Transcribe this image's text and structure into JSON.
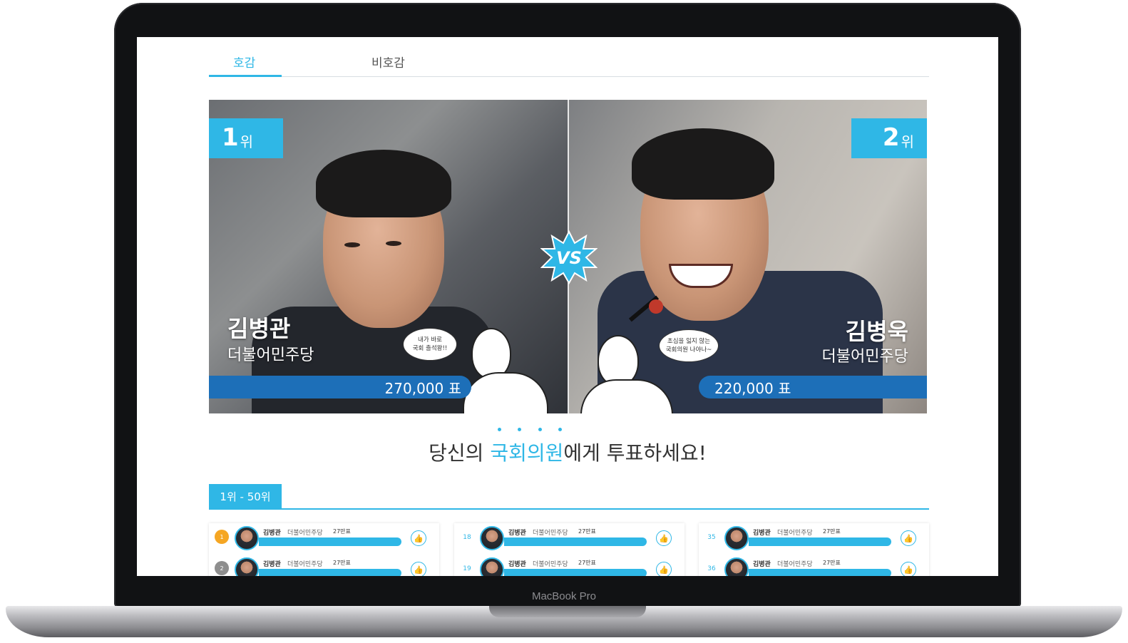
{
  "tabs": [
    {
      "label": "호감",
      "active": true
    },
    {
      "label": "비호감",
      "active": false
    }
  ],
  "hero": {
    "left": {
      "rank_num": "1",
      "rank_suffix": "위",
      "name": "김병관",
      "party": "더불어민주당",
      "votes": "270,000 표",
      "bubble_line1": "내가 바로",
      "bubble_line2": "국회 출석왕!!"
    },
    "right": {
      "rank_num": "2",
      "rank_suffix": "위",
      "name": "김병욱",
      "party": "더불어민주당",
      "votes": "220,000 표",
      "bubble_line1": "초심을 잃지 않는",
      "bubble_line2": "국회의원 나야나~"
    },
    "vs_label": "VS"
  },
  "prompt": {
    "before": "당신의 ",
    "highlight": "국회의원",
    "after": "에게 투표하세요!"
  },
  "range_tab": "1위 - 50위",
  "ranking": {
    "columns": [
      {
        "rows": [
          {
            "rank": "1",
            "name": "김병관",
            "party": "더불어민주당",
            "votes": "27만표",
            "badge": "gold"
          },
          {
            "rank": "2",
            "name": "김병관",
            "party": "더불어민주당",
            "votes": "27만표",
            "badge": "grey"
          }
        ]
      },
      {
        "rows": [
          {
            "rank": "18",
            "name": "김병관",
            "party": "더불어민주당",
            "votes": "27만표"
          },
          {
            "rank": "19",
            "name": "김병관",
            "party": "더불어민주당",
            "votes": "27만표"
          }
        ]
      },
      {
        "rows": [
          {
            "rank": "35",
            "name": "김병관",
            "party": "더불어민주당",
            "votes": "27만표"
          },
          {
            "rank": "36",
            "name": "김병관",
            "party": "더불어민주당",
            "votes": "27만표"
          }
        ]
      }
    ]
  },
  "device_label": "MacBook Pro",
  "colors": {
    "accent": "#2fb7e6",
    "vote_bar": "#1d6fb8"
  },
  "icons": {
    "like": "thumbs-up-icon",
    "vs": "vs-burst-icon"
  }
}
